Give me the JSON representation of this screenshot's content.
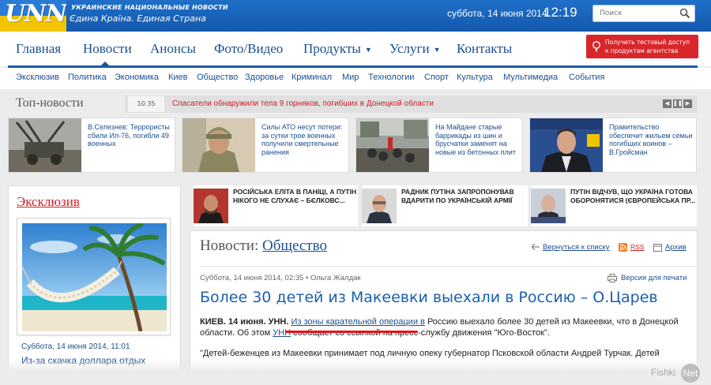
{
  "header": {
    "logo_text": "UNN",
    "tagline_top": "УКРАИНСКИЕ НАЦИОНАЛЬНЫЕ НОВОСТИ",
    "tagline_bottom": "Єдина Країна. Единая Страна",
    "date": "суббота, 14 июня 2014",
    "time": "12:19",
    "search_placeholder": "Поиск",
    "bg_color": "#1a64bd"
  },
  "main_nav": {
    "items": [
      "Главная",
      "Новости",
      "Анонсы",
      "Фото/Видео",
      "Продукты",
      "Услуги",
      "Контакты"
    ],
    "active": "Новости",
    "promo": "Получить тестовый доступ к продуктам агентства",
    "promo_color": "#d8262b"
  },
  "sub_nav": {
    "items": [
      "Эксклюзив",
      "Политика",
      "Экономика",
      "Киев",
      "Общество",
      "Здоровье",
      "Криминал",
      "Мир",
      "Технологии",
      "Спорт",
      "Культура",
      "Мультимедиа",
      "События"
    ]
  },
  "top_news": {
    "title": "Топ-новости",
    "ticker_time": "10:35",
    "ticker_text": "Спасатели обнаружили тела 9 горняков, погибших в Донецкой области",
    "ticker_color": "#c81f24",
    "cards": [
      {
        "text": "В.Селезнев: Террористы сбили Ил-76, погибли 49 военных",
        "image": "artillery-photo"
      },
      {
        "text": "Силы АТО несут потери: за сутки трое военных получили смертельные ранения",
        "image": "soldier-photo"
      },
      {
        "text": "На Майдане старые баррикады из шин и брусчатки заменят на новые из бетонных плит",
        "image": "maidan-photo"
      },
      {
        "text": "Правительство обеспечит жильем семьи погибших воинов – В.Гройсман",
        "image": "groysman-photo"
      }
    ]
  },
  "exclusive": {
    "title": "Эксклюзив",
    "date": "Суббота, 14 июня 2014, 11:01",
    "headline": "Из-за скачка доллара отдых",
    "image": "hammock-beach-photo"
  },
  "opinions": [
    {
      "text": "РОСІЙСЬКА ЕЛІТА В ПАНІЦІ, А ПУТІН НІКОГО НЕ СЛУХАЄ – БЄЛКОВС..."
    },
    {
      "text": "РАДНИК ПУТІНА ЗАПРОПОНУВАВ ВДАРИТИ ПО УКРАЇНСЬКІЙ АРМІЇ"
    },
    {
      "text": "ПУТІН ВІДЧУВ, ЩО УКРАЇНА ГОТОВА ОБОРОНЯТИСЯ (ЄВРОПЕЙСЬКА ПР..."
    }
  ],
  "article": {
    "section_prefix": "Новости:",
    "section": "Общество",
    "back_link": "Вернуться к списку",
    "rss": "RSS",
    "archive": "Архив",
    "meta": "Суббота, 14 июня 2014, 02:35 • Ольга Жалдак",
    "print": "Версия для печати",
    "title": "Более 30 детей из Макеевки выехали в Россию – О.Царев",
    "lead_bold": "КИЕВ. 14 июня. УНН.",
    "lead_link": "Из зоны карательной операции в",
    "lead_rest": "Россию выехало более 30 детей из Макеевки, что в Донецкой области. Об этом",
    "lead_link2": "УНН",
    "lead_end": "сообщает со ссылкой на пресс-службу движения \"Юго-Восток\".",
    "para2": "\"Детей-беженцев из Макеевки принимает под личную опеку губернатор Псковской области Андрей Турчак. Детей",
    "highlight_color": "#e2141b",
    "title_color": "#1b5fb0"
  },
  "watermark": {
    "text": "Fishki",
    "circle": "Net"
  }
}
